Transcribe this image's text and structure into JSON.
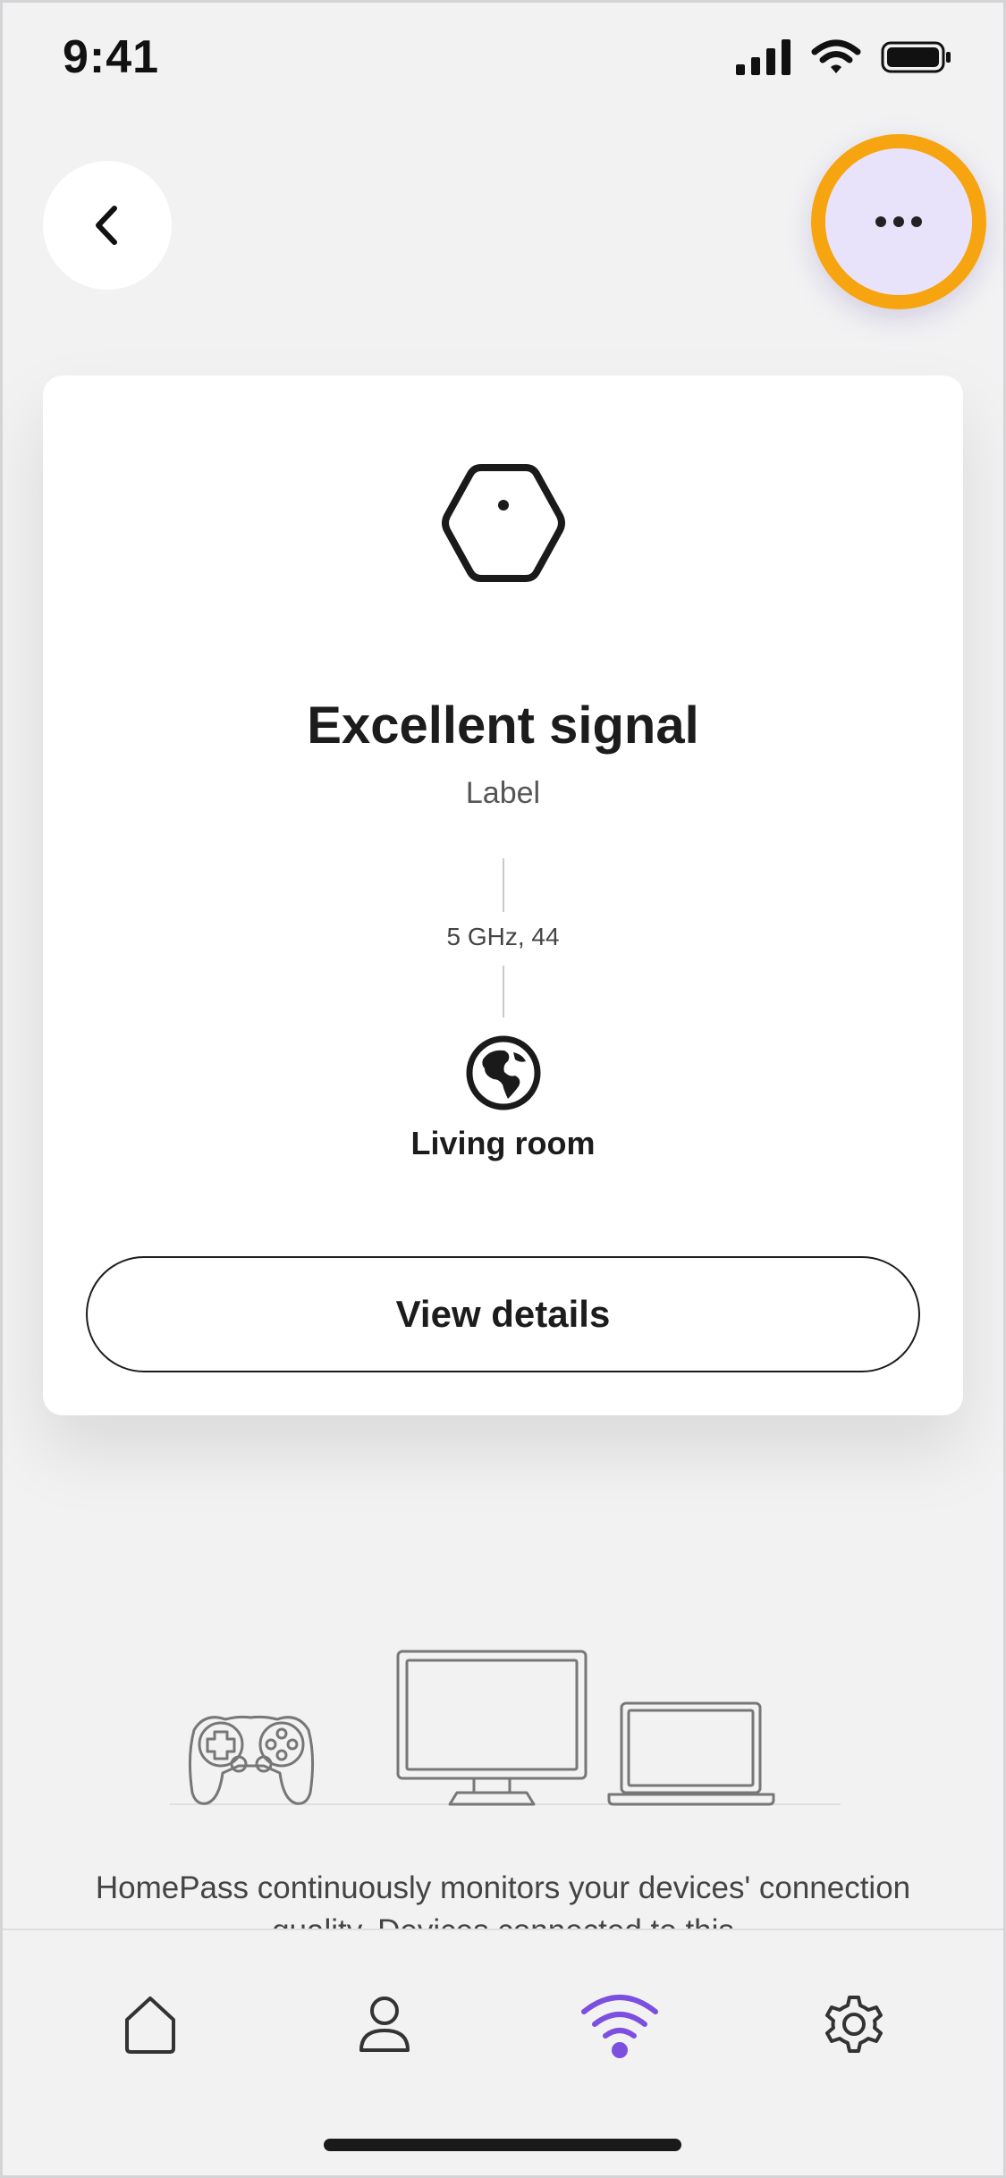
{
  "status_bar": {
    "time": "9:41"
  },
  "header": {
    "back_icon": "chevron-left-icon",
    "more_icon": "ellipsis-icon",
    "highlight_color": "#f6a511",
    "more_bg_color": "#e8e3fb"
  },
  "card": {
    "device_icon": "hexagon-pod-icon",
    "title": "Excellent signal",
    "label": "Label",
    "band": "5 GHz, 44",
    "location_icon": "globe-icon",
    "location": "Living room",
    "details_button": "View details"
  },
  "illustration": {
    "icons": [
      "gamepad-icon",
      "monitor-icon",
      "laptop-icon"
    ]
  },
  "description": "HomePass continuously monitors your devices' connection quality. Devices connected to this",
  "tab_bar": {
    "tabs": [
      {
        "icon": "home-icon",
        "active": false
      },
      {
        "icon": "person-icon",
        "active": false
      },
      {
        "icon": "wifi-icon",
        "active": true
      },
      {
        "icon": "gear-icon",
        "active": false
      }
    ],
    "active_color": "#7c4fe0"
  }
}
